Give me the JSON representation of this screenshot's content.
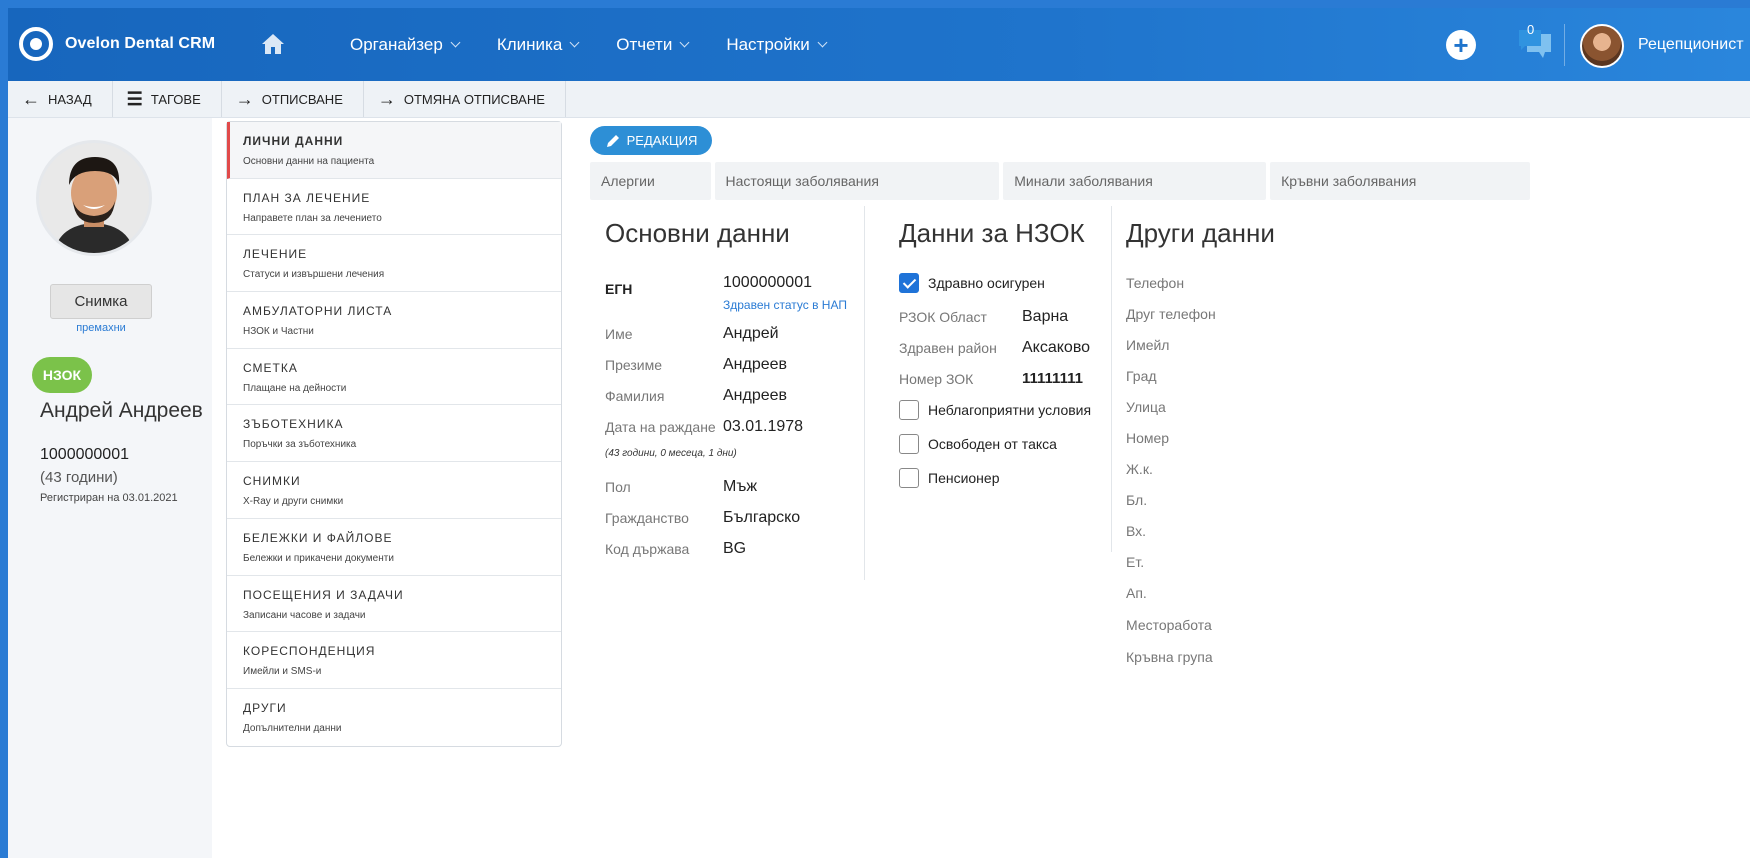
{
  "app": {
    "name": "Ovelon Dental CRM"
  },
  "nav": [
    {
      "label": "Органайзер"
    },
    {
      "label": "Клиника"
    },
    {
      "label": "Отчети"
    },
    {
      "label": "Настройки"
    }
  ],
  "header": {
    "messages_count": "0",
    "user_role": "Рецепционист"
  },
  "toolbar": {
    "back": "НАЗАД",
    "tags": "ТАГОВЕ",
    "checkout": "ОТПИСВАНЕ",
    "cancel_checkout": "ОТМЯНА ОТПИСВАНЕ"
  },
  "patient": {
    "photo_button": "Снимка",
    "remove_photo": "премахни",
    "badge": "НЗОК",
    "full_name": "Андрей Андреев",
    "egn": "1000000001",
    "age": "(43 години)",
    "registered": "Регистриран на 03.01.2021"
  },
  "menu": [
    {
      "title": "ЛИЧНИ ДАННИ",
      "sub": "Основни данни на пациента"
    },
    {
      "title": "ПЛАН ЗА ЛЕЧЕНИЕ",
      "sub": "Направете план за лечението"
    },
    {
      "title": "ЛЕЧЕНИЕ",
      "sub": "Статуси и извършени лечения"
    },
    {
      "title": "АМБУЛАТОРНИ ЛИСТА",
      "sub": "НЗОК и Частни"
    },
    {
      "title": "СМЕТКА",
      "sub": "Плащане на дейности"
    },
    {
      "title": "ЗЪБОТЕХНИКА",
      "sub": "Поръчки за зъботехника"
    },
    {
      "title": "СНИМКИ",
      "sub": "X-Ray и други снимки"
    },
    {
      "title": "БЕЛЕЖКИ И ФАЙЛОВЕ",
      "sub": "Бележки и прикачени документи"
    },
    {
      "title": "ПОСЕЩЕНИЯ И ЗАДАЧИ",
      "sub": "Записани часове и задачи"
    },
    {
      "title": "КОРЕСПОНДЕНЦИЯ",
      "sub": "Имейли и SMS-и"
    },
    {
      "title": "ДРУГИ",
      "sub": "Допълнителни данни"
    }
  ],
  "main": {
    "edit_label": "РЕДАКЦИЯ",
    "tabs": [
      {
        "label": "Алергии"
      },
      {
        "label": "Настоящи заболявания"
      },
      {
        "label": "Минали заболявания"
      },
      {
        "label": "Кръвни заболявания"
      }
    ],
    "basic": {
      "title": "Основни данни",
      "egn_label": "ЕГН",
      "egn_value": "1000000001",
      "nap_link": "Здравен статус в НАП",
      "first_name_label": "Име",
      "first_name": "Андрей",
      "middle_name_label": "Презиме",
      "middle_name": "Андреев",
      "last_name_label": "Фамилия",
      "last_name": "Андреев",
      "dob_label": "Дата на раждане",
      "dob": "03.01.1978",
      "age_note": "(43 години, 0 месеца, 1 дни)",
      "gender_label": "Пол",
      "gender": "Мъж",
      "citizenship_label": "Гражданство",
      "citizenship": "Българско",
      "country_label": "Код държава",
      "country": "BG"
    },
    "nzok": {
      "title": "Данни за НЗОК",
      "insured_label": "Здравно осигурен",
      "rzok_label": "РЗОК Област",
      "rzok": "Варна",
      "district_label": "Здравен район",
      "district": "Аксаково",
      "zok_label": "Номер ЗОК",
      "zok": "11111111",
      "adverse_label": "Неблагоприятни условия",
      "exempt_label": "Освободен от такса",
      "pensioner_label": "Пенсионер"
    },
    "other": {
      "title": "Други данни",
      "fields": [
        "Телефон",
        "Друг телефон",
        "Имейл",
        "Град",
        "Улица",
        "Номер",
        "Ж.к.",
        "Бл.",
        "Вх.",
        "Ет.",
        "Ап.",
        "Месторабота",
        "Кръвна група"
      ]
    }
  }
}
